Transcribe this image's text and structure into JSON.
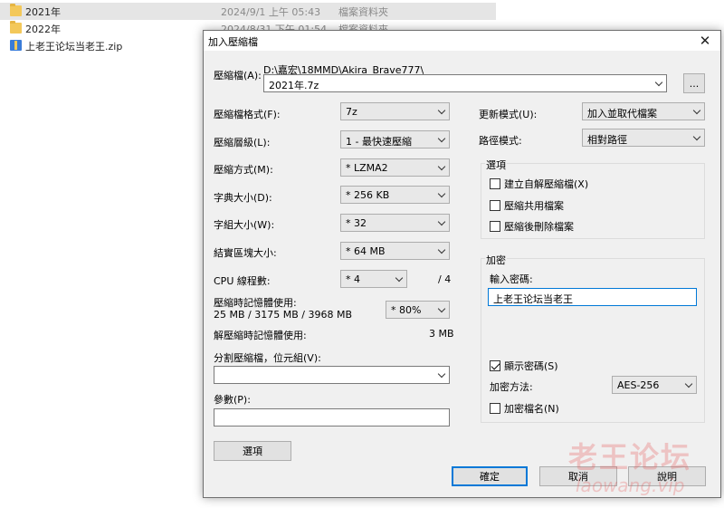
{
  "explorer": {
    "files": [
      {
        "name": "2021年",
        "date": "2024/9/1 上午 05:43",
        "type": "檔案資料夾",
        "icon": "folder-icon"
      },
      {
        "name": "2022年",
        "date": "2024/8/31 下午 01:54",
        "type": "檔案資料夾",
        "icon": "folder-icon"
      },
      {
        "name": "上老王论坛当老王.zip",
        "date": "",
        "type": "",
        "icon": "zip-icon"
      }
    ]
  },
  "dialog": {
    "title": "加入壓縮檔",
    "close_glyph": "✕",
    "archive_label": "壓縮檔(A):",
    "archive_path": "D:\\嘉宏\\18MMD\\Akira_Brave777\\",
    "archive_name": "2021年.7z",
    "browse_label": "...",
    "format_label": "壓縮檔格式(F):",
    "format_value": "7z",
    "level_label": "壓縮層級(L):",
    "level_value": "1 - 最快速壓縮",
    "method_label": "壓縮方式(M):",
    "method_value": "* LZMA2",
    "dict_label": "字典大小(D):",
    "dict_value": "* 256 KB",
    "word_label": "字組大小(W):",
    "word_value": "* 32",
    "solid_label": "結實區塊大小:",
    "solid_value": "* 64 MB",
    "cpu_label": "CPU 線程數:",
    "cpu_value": "* 4",
    "cpu_max": "/ 4",
    "mem_comp_label": "壓縮時記憶體使用:",
    "mem_comp_value": "25 MB / 3175 MB / 3968 MB",
    "mem_percent": "* 80%",
    "mem_decomp_label": "解壓縮時記憶體使用:",
    "mem_decomp_value": "3 MB",
    "split_label": "分割壓縮檔，位元組(V):",
    "split_value": "",
    "params_label": "參數(P):",
    "params_value": "",
    "options_button": "選項",
    "update_label": "更新模式(U):",
    "update_value": "加入並取代檔案",
    "path_label": "路徑模式:",
    "path_value": "相對路徑",
    "options_group": "選項",
    "opt_sfx": "建立自解壓縮檔(X)",
    "opt_shared": "壓縮共用檔案",
    "opt_delete": "壓縮後刪除檔案",
    "encrypt_group": "加密",
    "password_label": "輸入密碼:",
    "password_value": "上老王论坛当老王",
    "show_password": "顯示密碼(S)",
    "enc_method_label": "加密方法:",
    "enc_method_value": "AES-256",
    "encrypt_names": "加密檔名(N)",
    "ok_button": "確定",
    "cancel_button": "取消",
    "help_button": "說明"
  },
  "watermark": {
    "line1": "老王论坛",
    "line2": "laowang.vip"
  }
}
